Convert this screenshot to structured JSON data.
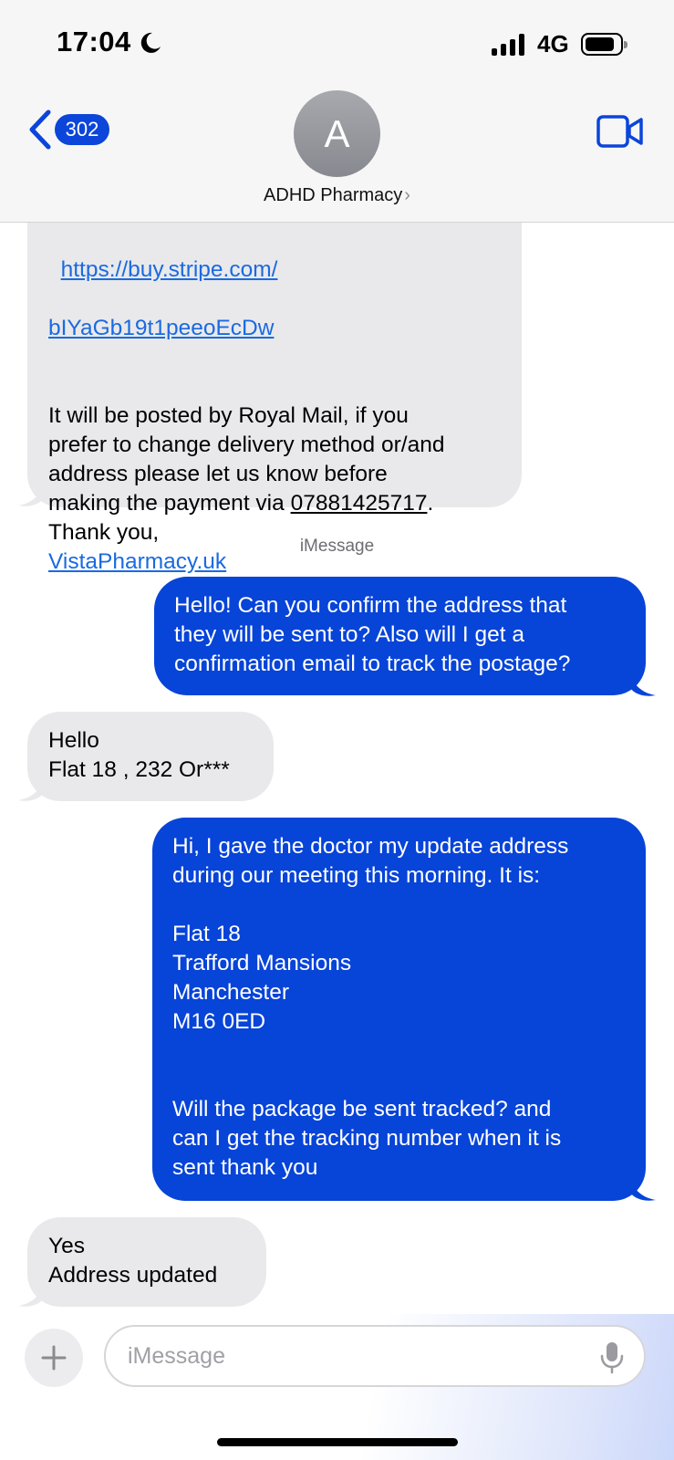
{
  "status_bar": {
    "time": "17:04",
    "network": "4G"
  },
  "header": {
    "back_count": "302",
    "avatar_initial": "A",
    "contact_name": "ADHD Pharmacy",
    "chevron": "›"
  },
  "messages": {
    "m1": {
      "link_line1": "https://buy.stripe.com/",
      "link_line2": "bIYaGb19t1peeoEcDw",
      "text_before_phone": "It will be posted by Royal Mail, if you\nprefer to change delivery method or/and\naddress please let us know before\nmaking the payment via ",
      "phone": "07881425717",
      "text_after_phone": ".\nThank you,\n",
      "site_link": "VistaPharmacy.uk"
    },
    "service_label": "iMessage",
    "m2": "Hello! Can you confirm the address that\nthey will be sent to? Also will I get a\nconfirmation email to track the postage?",
    "m3": "Hello\nFlat 18 , 232 Or***",
    "m4": "Hi, I gave the doctor my update address\nduring our meeting this morning. It is:\n\nFlat 18\nTrafford Mansions\nManchester\nM16 0ED\n\n\nWill the package be sent tracked? and\ncan I get the tracking number when it is\nsent thank you",
    "m5": "Yes\nAddress updated"
  },
  "composer": {
    "placeholder": "iMessage"
  },
  "icons": [
    "moon-icon",
    "cellular-signal-icon",
    "battery-icon",
    "back-chevron-icon",
    "video-camera-icon",
    "plus-icon",
    "microphone-icon"
  ],
  "colors": {
    "outgoing_bubble": "#0744d8",
    "incoming_bubble": "#e9e9eb",
    "link": "#1a6ae0",
    "badge": "#0b45d9"
  }
}
